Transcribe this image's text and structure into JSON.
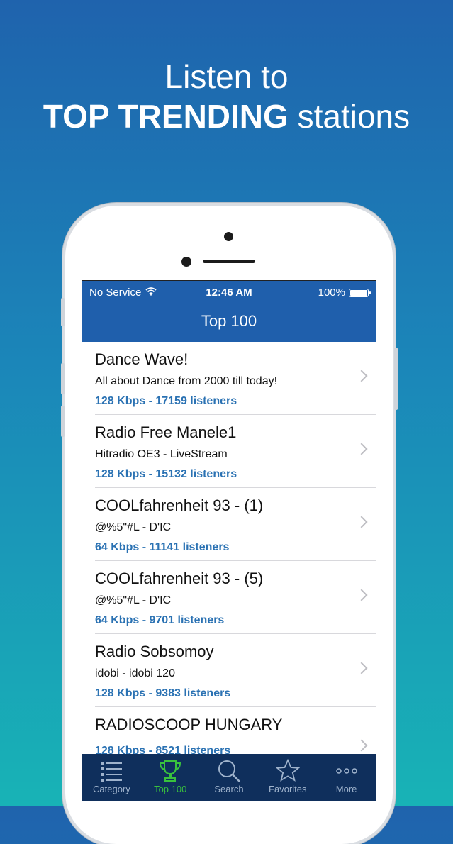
{
  "promo": {
    "line1": "Listen to",
    "line2_bold": "TOP TRENDING",
    "line2_rest": "stations"
  },
  "status_bar": {
    "carrier": "No Service",
    "time": "12:46 AM",
    "battery": "100%"
  },
  "nav": {
    "title": "Top 100"
  },
  "stations": [
    {
      "name": "Dance Wave!",
      "subtitle": "All about Dance from 2000 till today!",
      "meta": "128 Kbps - 17159 listeners"
    },
    {
      "name": "Radio Free Manele1",
      "subtitle": "Hitradio OE3 - LiveStream",
      "meta": "128 Kbps - 15132 listeners"
    },
    {
      "name": "COOLfahrenheit 93 - (1)",
      "subtitle": "@%5\"#L - D'IC",
      "meta": "64 Kbps - 11141 listeners"
    },
    {
      "name": "COOLfahrenheit 93 - (5)",
      "subtitle": "@%5\"#L - D'IC",
      "meta": "64 Kbps - 9701 listeners"
    },
    {
      "name": "Radio Sobsomoy",
      "subtitle": "idobi - idobi 120",
      "meta": "128 Kbps - 9383 listeners"
    },
    {
      "name": "RADIOSCOOP HUNGARY",
      "subtitle": "",
      "meta": "128 Kbps - 8521 listeners"
    }
  ],
  "tabs": [
    {
      "label": "Category",
      "icon": "list-icon",
      "active": false
    },
    {
      "label": "Top 100",
      "icon": "trophy-icon",
      "active": true
    },
    {
      "label": "Search",
      "icon": "search-icon",
      "active": false
    },
    {
      "label": "Favorites",
      "icon": "star-icon",
      "active": false
    },
    {
      "label": "More",
      "icon": "more-icon",
      "active": false
    }
  ],
  "colors": {
    "bar": "#1f5fac",
    "tabbar": "#0f2f5c",
    "active_tab": "#39c23d",
    "meta_text": "#2b72b3"
  }
}
